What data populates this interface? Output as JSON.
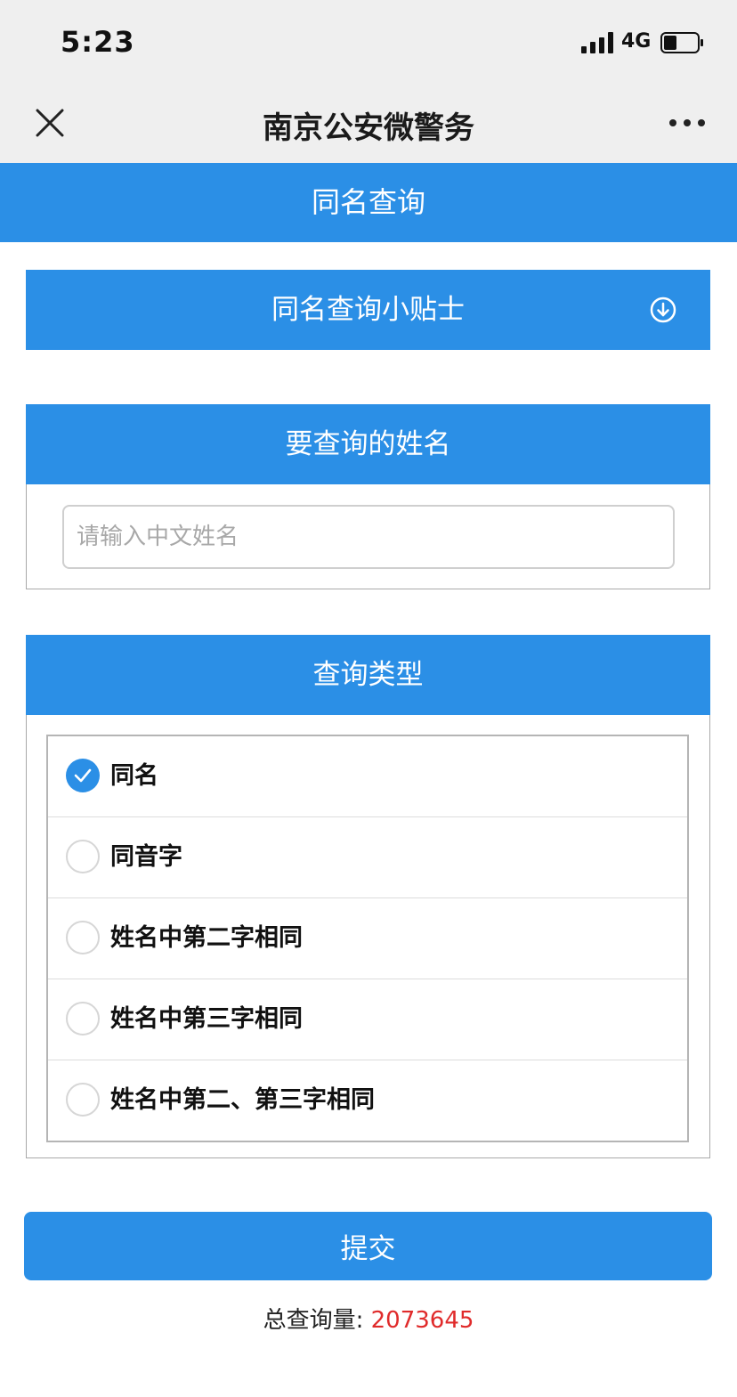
{
  "status_bar": {
    "time": "5:23",
    "network": "4G",
    "signal_icon": "signal-bars-icon",
    "battery_icon": "battery-icon"
  },
  "nav_bar": {
    "title": "南京公安微警务",
    "close_icon": "close-icon",
    "more_icon": "more-dots-icon"
  },
  "page": {
    "title": "同名查询"
  },
  "tips": {
    "label": "同名查询小贴士",
    "icon": "circle-arrow-down-icon"
  },
  "name_section": {
    "header": "要查询的姓名",
    "input_placeholder": "请输入中文姓名",
    "input_value": ""
  },
  "type_section": {
    "header": "查询类型",
    "selected": "同名",
    "options": [
      {
        "label": "同名"
      },
      {
        "label": "同音字"
      },
      {
        "label": "姓名中第二字相同"
      },
      {
        "label": "姓名中第三字相同"
      },
      {
        "label": "姓名中第二、第三字相同"
      }
    ]
  },
  "submit": {
    "label": "提交"
  },
  "stats": {
    "total_label": "总查询量:",
    "total_value": "2073645"
  },
  "colors": {
    "accent": "#2b8fe6",
    "count": "#e02b2b",
    "bar_background": "#efefef"
  }
}
